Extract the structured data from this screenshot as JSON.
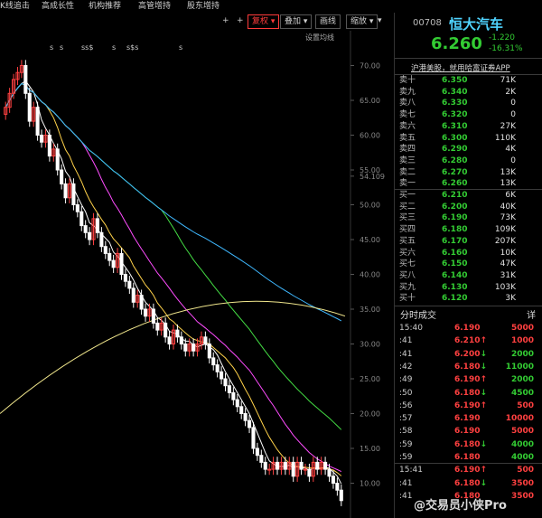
{
  "menu": [
    "K线追击",
    "高成长性",
    "机构推荐",
    "高管增持",
    "股东增持"
  ],
  "toolbar": {
    "plus1": "+",
    "plus2": "+",
    "adjust": "复权 ▾",
    "overlay": "叠加 ▾",
    "draw": "画线",
    "zoom_out": "缩放 ▾",
    "mark": "▾",
    "settings_label": "设置均线"
  },
  "markers": [
    "s",
    "s",
    "ss$",
    "s",
    "s$s",
    "s"
  ],
  "chart_data": {
    "type": "candlestick",
    "y_ticks": [
      "70.00",
      "65.00",
      "60.00",
      "55.00",
      "54.109",
      "50.00",
      "45.00",
      "40.00",
      "35.00",
      "30.00",
      "25.00",
      "20.00",
      "15.00",
      "10.00"
    ],
    "ylim": [
      5,
      75
    ],
    "highlight_price": "54.109",
    "closes": [
      64,
      66,
      68,
      69,
      70,
      66,
      62,
      64,
      60,
      59,
      60,
      57,
      58,
      55,
      53,
      51,
      53,
      50,
      49,
      47,
      46,
      45,
      48,
      46,
      44,
      43,
      42,
      41,
      43,
      40,
      39,
      38,
      36,
      37,
      35,
      34,
      35,
      33,
      32,
      33,
      31,
      30,
      32,
      31,
      30,
      29,
      30,
      29,
      30,
      31,
      30,
      28,
      27,
      26,
      25,
      24,
      23,
      22,
      21,
      20,
      19,
      18,
      15,
      14,
      13,
      12,
      12,
      13,
      12,
      13,
      12,
      13,
      11,
      13,
      12,
      12,
      11,
      13,
      12,
      13,
      12,
      11,
      10,
      9,
      7.5
    ]
  },
  "header": {
    "code": "00708",
    "name": "恒大汽车",
    "price": "6.260",
    "change": "-1.220",
    "pct": "-16.31%"
  },
  "ad": "沪港美股，就用哈富证券APP",
  "asks": [
    {
      "label": "卖十",
      "price": "6.350",
      "vol": "71K"
    },
    {
      "label": "卖九",
      "price": "6.340",
      "vol": "2K"
    },
    {
      "label": "卖八",
      "price": "6.330",
      "vol": "0"
    },
    {
      "label": "卖七",
      "price": "6.320",
      "vol": "0"
    },
    {
      "label": "卖六",
      "price": "6.310",
      "vol": "27K"
    },
    {
      "label": "卖五",
      "price": "6.300",
      "vol": "110K"
    },
    {
      "label": "卖四",
      "price": "6.290",
      "vol": "4K"
    },
    {
      "label": "卖三",
      "price": "6.280",
      "vol": "0"
    },
    {
      "label": "卖二",
      "price": "6.270",
      "vol": "13K"
    },
    {
      "label": "卖一",
      "price": "6.260",
      "vol": "13K"
    }
  ],
  "bids": [
    {
      "label": "买一",
      "price": "6.210",
      "vol": "6K"
    },
    {
      "label": "买二",
      "price": "6.200",
      "vol": "40K"
    },
    {
      "label": "买三",
      "price": "6.190",
      "vol": "73K"
    },
    {
      "label": "买四",
      "price": "6.180",
      "vol": "109K"
    },
    {
      "label": "买五",
      "price": "6.170",
      "vol": "207K"
    },
    {
      "label": "买六",
      "price": "6.160",
      "vol": "10K"
    },
    {
      "label": "买七",
      "price": "6.150",
      "vol": "47K"
    },
    {
      "label": "买八",
      "price": "6.140",
      "vol": "31K"
    },
    {
      "label": "买九",
      "price": "6.130",
      "vol": "103K"
    },
    {
      "label": "买十",
      "price": "6.120",
      "vol": "3K"
    }
  ],
  "trades_title": "分时成交",
  "trades_detail": "详",
  "trades": [
    {
      "time": "15:40",
      "price": "6.190",
      "arrow": "",
      "vol": "5000",
      "pc": "up",
      "vc": "up"
    },
    {
      "time": ":41",
      "price": "6.210",
      "arrow": "↑",
      "vol": "1000",
      "pc": "up",
      "vc": "up"
    },
    {
      "time": ":41",
      "price": "6.200",
      "arrow": "↓",
      "vol": "2000",
      "pc": "up",
      "vc": "dn"
    },
    {
      "time": ":42",
      "price": "6.180",
      "arrow": "↓",
      "vol": "11000",
      "pc": "up",
      "vc": "dn"
    },
    {
      "time": ":49",
      "price": "6.190",
      "arrow": "↑",
      "vol": "2000",
      "pc": "up",
      "vc": "dn"
    },
    {
      "time": ":50",
      "price": "6.180",
      "arrow": "↓",
      "vol": "4500",
      "pc": "up",
      "vc": "dn"
    },
    {
      "time": ":56",
      "price": "6.190",
      "arrow": "↑",
      "vol": "500",
      "pc": "up",
      "vc": "up"
    },
    {
      "time": ":57",
      "price": "6.190",
      "arrow": "",
      "vol": "10000",
      "pc": "up",
      "vc": "up"
    },
    {
      "time": ":58",
      "price": "6.190",
      "arrow": "",
      "vol": "5000",
      "pc": "up",
      "vc": "up"
    },
    {
      "time": ":59",
      "price": "6.180",
      "arrow": "↓",
      "vol": "4000",
      "pc": "up",
      "vc": "dn"
    },
    {
      "time": ":59",
      "price": "6.180",
      "arrow": "",
      "vol": "4000",
      "pc": "up",
      "vc": "dn"
    },
    {
      "time": "15:41",
      "price": "6.190",
      "arrow": "↑",
      "vol": "500",
      "pc": "up",
      "vc": "up"
    },
    {
      "time": ":41",
      "price": "6.180",
      "arrow": "↓",
      "vol": "3500",
      "pc": "up",
      "vc": "up"
    },
    {
      "time": ":41",
      "price": "6.180",
      "arrow": "",
      "vol": "3500",
      "pc": "up",
      "vc": "up"
    }
  ],
  "watermark": "@交易员小侠Pro"
}
